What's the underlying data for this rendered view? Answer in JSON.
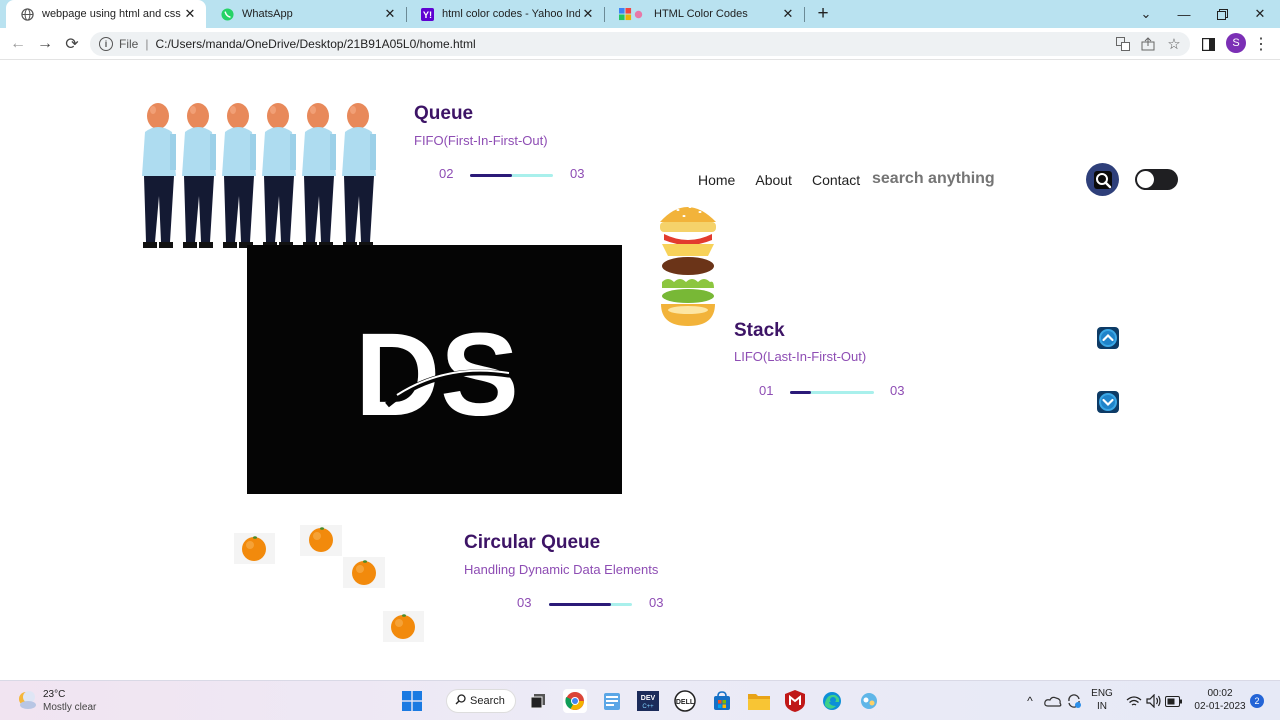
{
  "browser": {
    "tabs": [
      {
        "title": "webpage using html and css",
        "icon": "globe-icon"
      },
      {
        "title": "WhatsApp",
        "icon": "whatsapp-icon"
      },
      {
        "title": "html color codes - Yahoo India Se",
        "icon": "yahoo-icon"
      },
      {
        "title": "HTML Color Codes",
        "icon": "color-codes-icon"
      }
    ],
    "address": {
      "scheme_label": "File",
      "url": "C:/Users/manda/OneDrive/Desktop/21B91A05L0/home.html"
    },
    "profile_initial": "S"
  },
  "page": {
    "queue": {
      "title": "Queue",
      "subtitle": "FIFO(First-In-First-Out)",
      "current": "02",
      "total": "03",
      "progress": 0.5
    },
    "stack": {
      "title": "Stack",
      "subtitle": "LIFO(Last-In-First-Out)",
      "current": "01",
      "total": "03",
      "progress": 0.25
    },
    "circular_queue": {
      "title": "Circular Queue",
      "subtitle": "Handling Dynamic Data Elements",
      "current": "03",
      "total": "03",
      "progress": 0.75
    },
    "nav": {
      "links": [
        "Home",
        "About",
        "Contact"
      ],
      "search_placeholder": "search anything"
    },
    "logo_text": "DS"
  },
  "taskbar": {
    "weather_temp": "23°C",
    "weather_desc": "Mostly clear",
    "search_label": "Search",
    "lang_top": "ENG",
    "lang_bottom": "IN",
    "time": "00:02",
    "date": "02-01-2023",
    "notification_count": "2"
  },
  "colors": {
    "title": "#3d1466",
    "subtitle": "#8e4db4",
    "progress_fill": "#2b1a78",
    "progress_track": "#a9f0ec",
    "tabstrip": "#b9e2f0"
  }
}
